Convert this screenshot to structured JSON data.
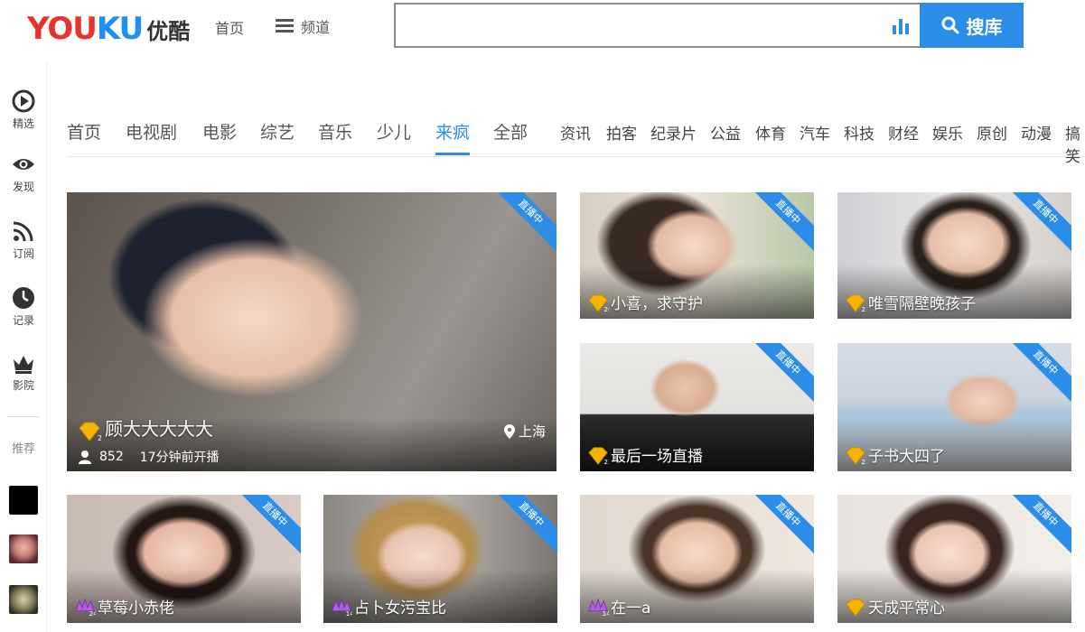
{
  "header": {
    "logo_latin_y": "YOU",
    "logo_latin_ku": "KU",
    "logo_cn": "优酷",
    "home_label": "首页",
    "channel_label": "频道",
    "search_placeholder": "",
    "search_button_label": "搜库",
    "colors": {
      "brand_red": "#e8322b",
      "brand_blue": "#1f8ff0",
      "accent": "#2b8de8"
    }
  },
  "sidebar": {
    "items": [
      {
        "label": "精选",
        "icon": "play-circle-icon"
      },
      {
        "label": "发现",
        "icon": "eye-icon"
      },
      {
        "label": "订阅",
        "icon": "rss-icon"
      },
      {
        "label": "记录",
        "icon": "clock-icon"
      },
      {
        "label": "影院",
        "icon": "crown-icon"
      }
    ],
    "recommend_label": "推荐"
  },
  "tabs": {
    "primary": [
      "首页",
      "电视剧",
      "电影",
      "综艺",
      "音乐",
      "少儿",
      "来疯",
      "全部"
    ],
    "active": "来疯",
    "secondary": [
      "资讯",
      "拍客",
      "纪录片",
      "公益",
      "体育",
      "汽车",
      "科技",
      "财经",
      "娱乐",
      "原创",
      "动漫",
      "搞笑"
    ]
  },
  "live_badge": "直播中",
  "featured": {
    "name": "顾大大大大大",
    "level": "23",
    "viewers": "852",
    "started": "17分钟前开播",
    "location": "上海"
  },
  "cards": [
    {
      "name": "小喜，求守护",
      "level": "20",
      "badge": "gold"
    },
    {
      "name": "唯雪隔壁晚孩子",
      "level": "23",
      "badge": "gold"
    },
    {
      "name": "最后一场直播",
      "level": "22",
      "badge": "gold"
    },
    {
      "name": "子书大四了",
      "level": "23",
      "badge": "gold"
    },
    {
      "name": "草莓小赤佬",
      "level": "24",
      "badge": "purple"
    },
    {
      "name": "占卜女污宝比",
      "level": "14",
      "badge": "purple"
    },
    {
      "name": "在一a",
      "level": "14",
      "badge": "purple"
    },
    {
      "name": "天成平常心",
      "level": "",
      "badge": "gold"
    }
  ]
}
